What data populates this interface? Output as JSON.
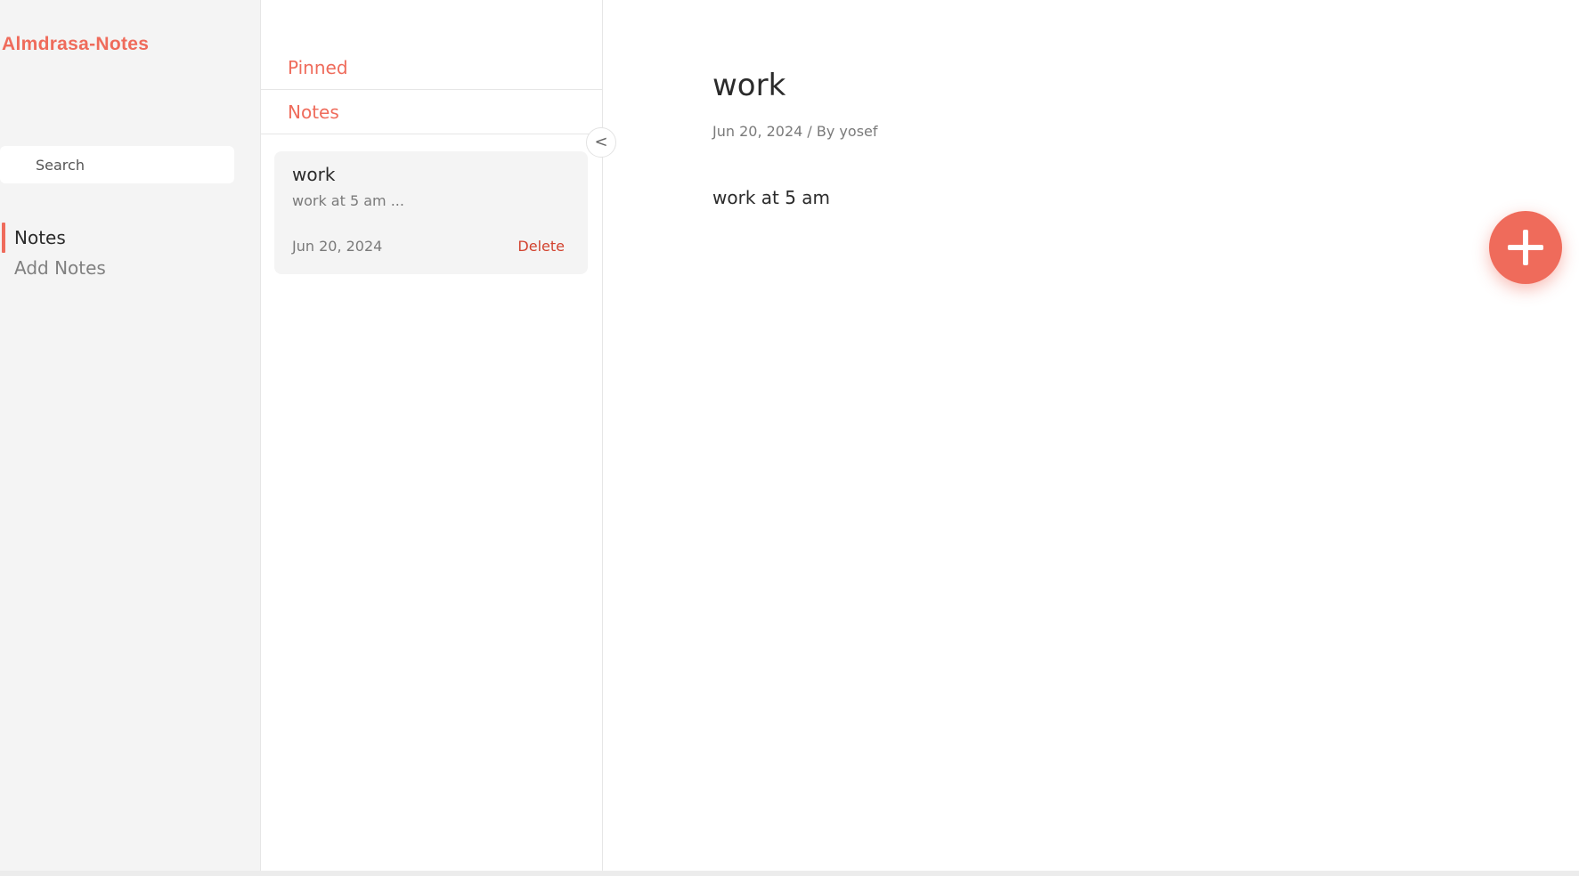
{
  "app": {
    "brand": "Almdrasa-Notes",
    "accent_color": "#ef6b5b",
    "delete_color": "#d2422e"
  },
  "sidebar": {
    "search": {
      "placeholder": "Search",
      "value": ""
    },
    "items": [
      {
        "label": "Notes",
        "active": true
      },
      {
        "label": "Add Notes",
        "active": false
      }
    ]
  },
  "list": {
    "tabs": {
      "pinned": "Pinned",
      "notes": "Notes"
    },
    "collapse_label": "<",
    "notes": [
      {
        "title": "work",
        "excerpt": "work at 5 am ...",
        "date": "Jun 20, 2024",
        "delete_label": "Delete"
      }
    ]
  },
  "detail": {
    "title": "work",
    "meta": "Jun 20, 2024 / By yosef",
    "body": "work at 5 am"
  },
  "fab": {
    "icon": "plus-icon"
  }
}
